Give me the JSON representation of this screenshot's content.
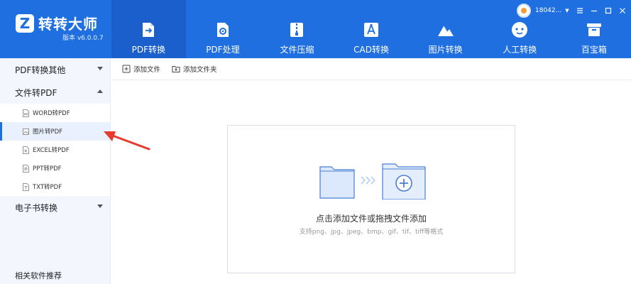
{
  "app": {
    "title": "转转大师",
    "version": "版本 v6.0.0.7",
    "logo_glyph": "Z"
  },
  "user": {
    "name": "18042..."
  },
  "nav": {
    "tabs": [
      {
        "label": "PDF转换",
        "icon": "pdf-convert-icon",
        "active": true
      },
      {
        "label": "PDF处理",
        "icon": "pdf-process-icon",
        "active": false
      },
      {
        "label": "文件压缩",
        "icon": "file-compress-icon",
        "active": false
      },
      {
        "label": "CAD转换",
        "icon": "cad-convert-icon",
        "active": false
      },
      {
        "label": "图片转换",
        "icon": "image-convert-icon",
        "active": false
      },
      {
        "label": "人工转换",
        "icon": "manual-convert-icon",
        "active": false
      },
      {
        "label": "百宝箱",
        "icon": "toolbox-icon",
        "active": false
      }
    ]
  },
  "sidebar": {
    "groups": [
      {
        "label": "PDF转换其他",
        "expanded": false
      },
      {
        "label": "文件转PDF",
        "expanded": true
      },
      {
        "label": "电子书转换",
        "expanded": false
      }
    ],
    "items": [
      {
        "label": "WORD转PDF",
        "selected": false
      },
      {
        "label": "图片转PDF",
        "selected": true
      },
      {
        "label": "EXCEL转PDF",
        "selected": false
      },
      {
        "label": "PPT转PDF",
        "selected": false
      },
      {
        "label": "TXT转PDF",
        "selected": false
      }
    ],
    "footer": "相关软件推荐"
  },
  "toolbar": {
    "add_file": "添加文件",
    "add_folder": "添加文件夹"
  },
  "dropzone": {
    "title": "点击添加文件或拖拽文件添加",
    "subtitle": "支持png、jpg、jpeg、bmp、gif、tif、tiff等格式"
  },
  "colors": {
    "brand": "#1f6fe0",
    "brand_dark": "#1a5fcb",
    "sidebar_bg": "#f3f7fd",
    "annotation": "#e8392f"
  }
}
